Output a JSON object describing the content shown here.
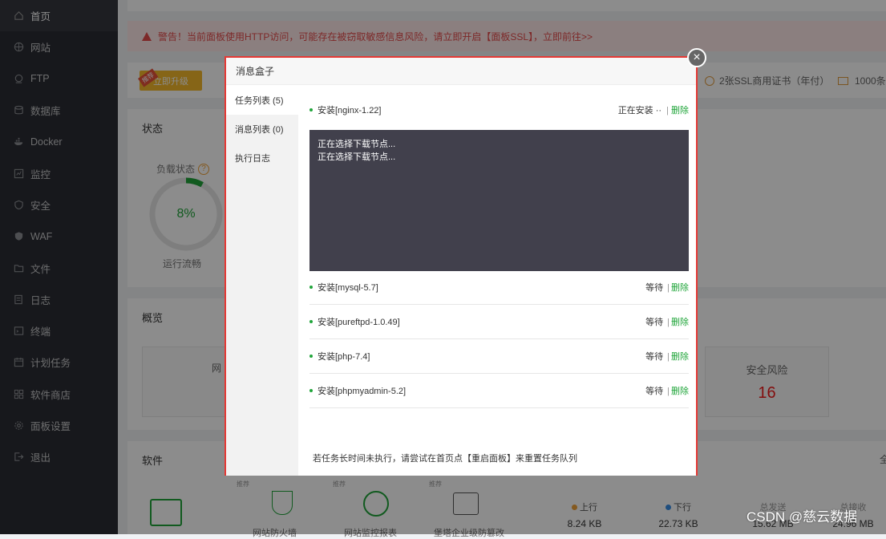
{
  "sidebar": {
    "items": [
      {
        "label": "首页",
        "icon": "home-icon"
      },
      {
        "label": "网站",
        "icon": "globe-icon"
      },
      {
        "label": "FTP",
        "icon": "ftp-icon"
      },
      {
        "label": "数据库",
        "icon": "database-icon"
      },
      {
        "label": "Docker",
        "icon": "docker-icon"
      },
      {
        "label": "监控",
        "icon": "monitor-icon"
      },
      {
        "label": "安全",
        "icon": "shield-icon"
      },
      {
        "label": "WAF",
        "icon": "waf-icon"
      },
      {
        "label": "文件",
        "icon": "folder-icon"
      },
      {
        "label": "日志",
        "icon": "log-icon"
      },
      {
        "label": "终端",
        "icon": "terminal-icon"
      },
      {
        "label": "计划任务",
        "icon": "calendar-icon"
      },
      {
        "label": "软件商店",
        "icon": "grid-icon"
      },
      {
        "label": "面板设置",
        "icon": "gear-icon"
      },
      {
        "label": "退出",
        "icon": "logout-icon"
      }
    ]
  },
  "warning": {
    "text": "警告！当前面板使用HTTP访问，可能存在被窃取敏感信息风险，请立即开启【面板SSL】，立即前往>>"
  },
  "upgrade": {
    "tag": "推荐",
    "label": "立即升级"
  },
  "promo": {
    "cert": "2张SSL商用证书（年付）",
    "mail": "1000条"
  },
  "status": {
    "title": "状态",
    "load_label": "负载状态",
    "load_help": "?",
    "load_value": "8%",
    "load_fraction": 0.08,
    "run_label": "运行流畅"
  },
  "overview": {
    "title": "概览",
    "risk_title": "安全风险",
    "risk_value": "16",
    "left_partial": "网"
  },
  "software": {
    "title": "软件",
    "items": [
      {
        "tag": "推荐",
        "label": "网站防火墙"
      },
      {
        "tag": "推荐",
        "label": "网站监控报表"
      },
      {
        "tag": "推荐",
        "label": "堡塔企业级防篡改"
      }
    ],
    "right_partial": "全"
  },
  "traffic": {
    "up_label": "上行",
    "up_value": "8.24 KB",
    "down_label": "下行",
    "down_value": "22.73 KB",
    "total_send_label": "总发送",
    "total_send_value": "15.62 MB",
    "total_recv_label": "总接收",
    "total_recv_value": "24.96 MB"
  },
  "modal": {
    "title": "消息盒子",
    "nav": [
      "任务列表 (5)",
      "消息列表 (0)",
      "执行日志"
    ],
    "first_task": {
      "name": "安装[nginx-1.22]",
      "status": "正在安装 ··",
      "sep": "|",
      "delete": "删除"
    },
    "console_lines": [
      "正在选择下载节点...",
      "正在选择下载节点..."
    ],
    "tasks": [
      {
        "name": "安装[mysql-5.7]",
        "status": "等待",
        "sep": "|",
        "delete": "删除"
      },
      {
        "name": "安装[pureftpd-1.0.49]",
        "status": "等待",
        "sep": "|",
        "delete": "删除"
      },
      {
        "name": "安装[php-7.4]",
        "status": "等待",
        "sep": "|",
        "delete": "删除"
      },
      {
        "name": "安装[phpmyadmin-5.2]",
        "status": "等待",
        "sep": "|",
        "delete": "删除"
      }
    ],
    "hint": "若任务长时间未执行，请尝试在首页点【重启面板】来重置任务队列",
    "close": "×"
  },
  "watermark": "CSDN @慈云数据",
  "colors": {
    "accent": "#20a53a",
    "danger": "#ef1b1b",
    "highlight": "#e53935",
    "sidebar": "#2b2d33"
  }
}
